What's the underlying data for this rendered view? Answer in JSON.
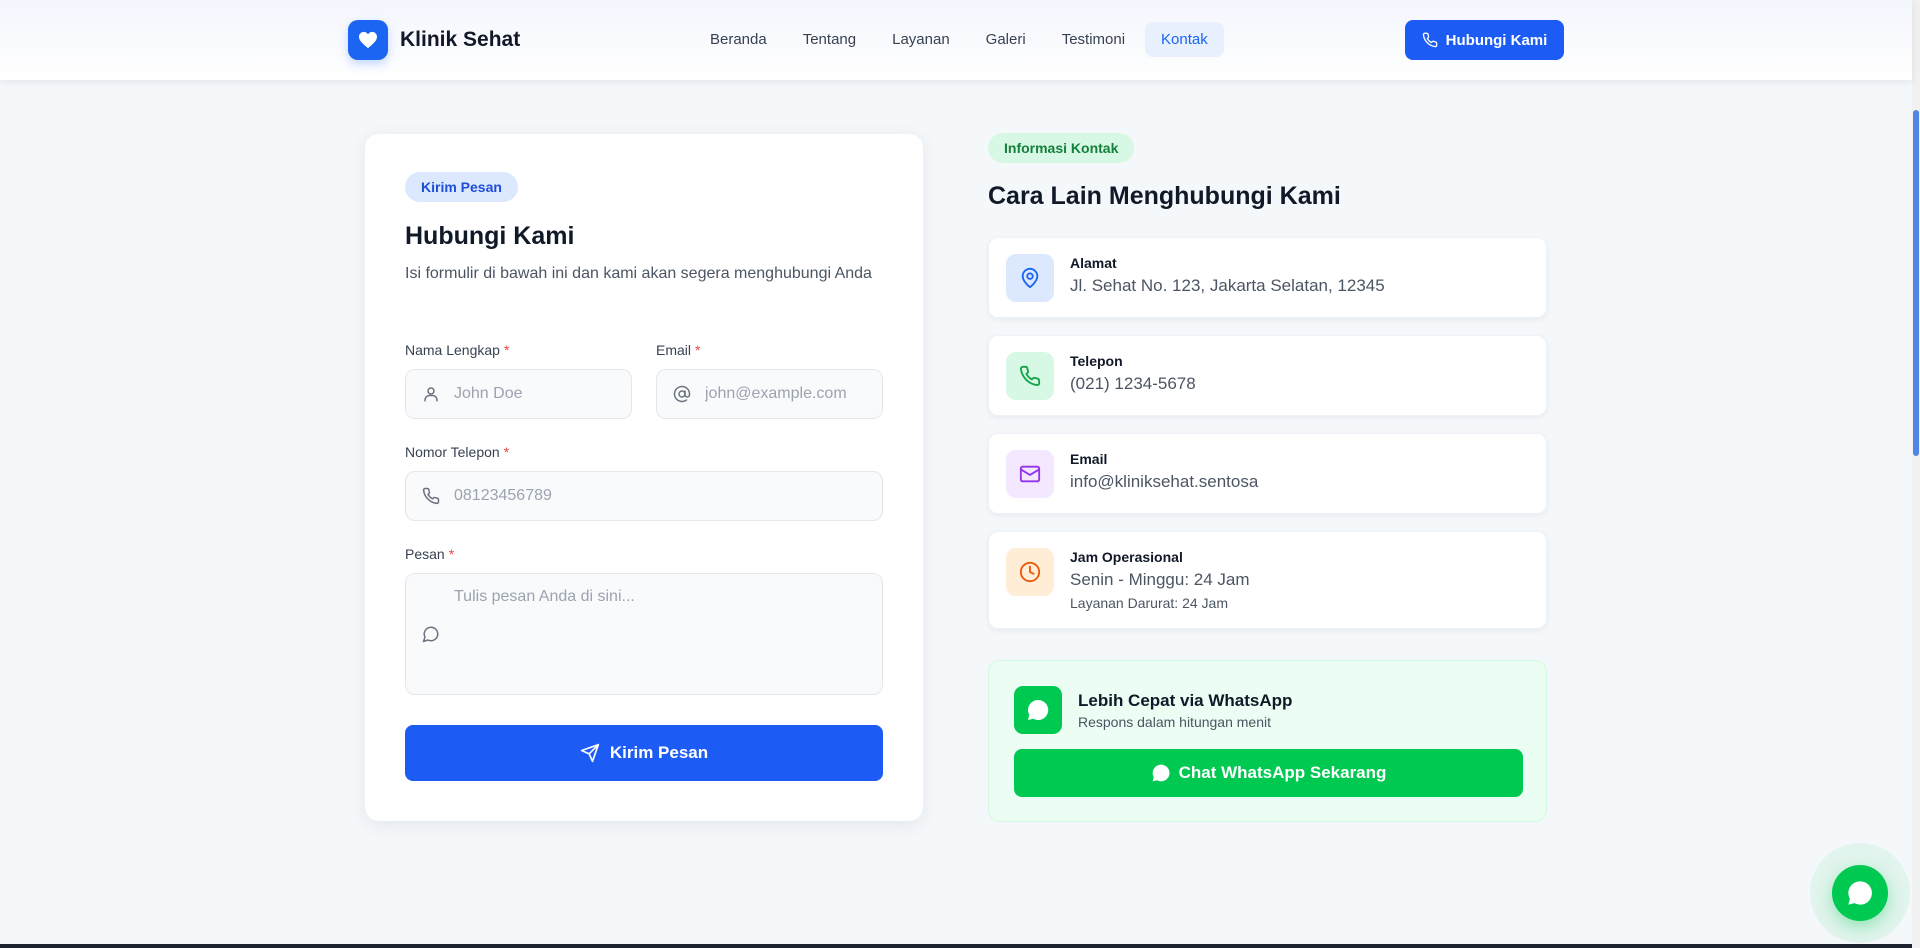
{
  "header": {
    "brand_name": "Klinik Sehat",
    "nav": [
      {
        "label": "Beranda"
      },
      {
        "label": "Tentang"
      },
      {
        "label": "Layanan"
      },
      {
        "label": "Galeri"
      },
      {
        "label": "Testimoni"
      },
      {
        "label": "Kontak",
        "active": true
      }
    ],
    "call_button": "Hubungi Kami"
  },
  "form": {
    "badge": "Kirim Pesan",
    "title": "Hubungi Kami",
    "subtitle": "Isi formulir di bawah ini dan kami akan segera menghubungi Anda",
    "required_mark": "*",
    "fields": {
      "name": {
        "label": "Nama Lengkap",
        "placeholder": "John Doe",
        "value": ""
      },
      "email": {
        "label": "Email",
        "placeholder": "john@example.com",
        "value": ""
      },
      "phone": {
        "label": "Nomor Telepon",
        "placeholder": "08123456789",
        "value": ""
      },
      "message": {
        "label": "Pesan",
        "placeholder": "Tulis pesan Anda di sini...",
        "value": ""
      }
    },
    "submit_label": "Kirim Pesan"
  },
  "contact": {
    "badge": "Informasi Kontak",
    "title": "Cara Lain Menghubungi Kami",
    "items": [
      {
        "label": "Alamat",
        "value": "Jl. Sehat No. 123, Jakarta Selatan, 12345",
        "icon": "map-pin-icon",
        "color": "#1c64f2",
        "bg": "#dbe8fe"
      },
      {
        "label": "Telepon",
        "value": "(021) 1234-5678",
        "icon": "phone-icon",
        "color": "#16a34a",
        "bg": "#d7f8e4"
      },
      {
        "label": "Email",
        "value": "info@kliniksehat.sentosa",
        "icon": "mail-icon",
        "color": "#9333ea",
        "bg": "#f3e8ff"
      },
      {
        "label": "Jam Operasional",
        "value": "Senin - Minggu: 24 Jam",
        "extra": "Layanan Darurat: 24 Jam",
        "icon": "clock-icon",
        "color": "#ea580c",
        "bg": "#ffedd5"
      }
    ]
  },
  "whatsapp": {
    "title": "Lebih Cepat via WhatsApp",
    "subtitle": "Respons dalam hitungan menit",
    "button": "Chat WhatsApp Sekarang"
  },
  "colors": {
    "primary": "#1c5cf5",
    "whatsapp": "#00c951",
    "required": "#ef4444"
  }
}
